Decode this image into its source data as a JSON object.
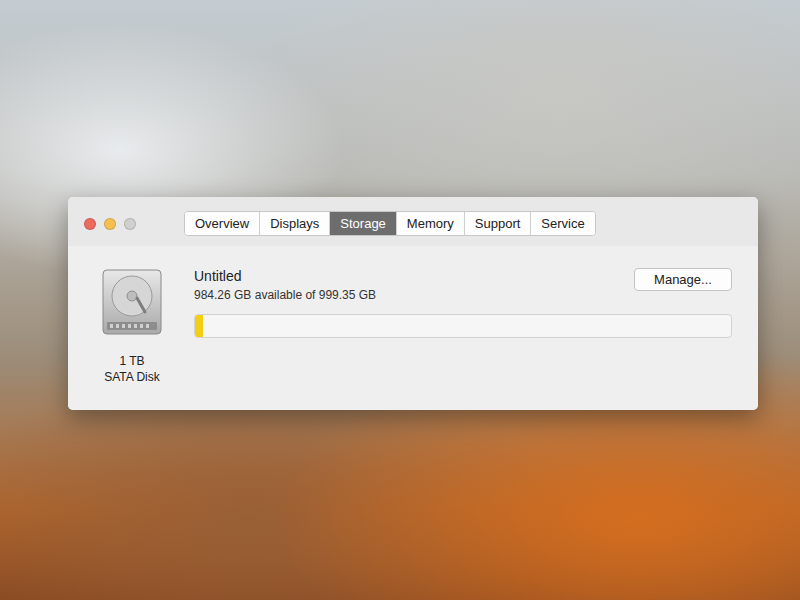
{
  "window": {
    "controls": [
      {
        "kind": "close",
        "disabled": false,
        "color": "#ed6a5e"
      },
      {
        "kind": "minimize",
        "disabled": false,
        "color": "#f5c04f"
      },
      {
        "kind": "zoom",
        "disabled": true,
        "color": "#d0d0d0"
      }
    ]
  },
  "tabs": [
    {
      "label": "Overview",
      "selected": false
    },
    {
      "label": "Displays",
      "selected": false
    },
    {
      "label": "Storage",
      "selected": true
    },
    {
      "label": "Memory",
      "selected": false
    },
    {
      "label": "Support",
      "selected": false
    },
    {
      "label": "Service",
      "selected": false
    }
  ],
  "disk": {
    "name": "Untitled",
    "capacity": "984.26 GB available of 999.35 GB",
    "size": "1 TB",
    "type": "SATA Disk",
    "level": 0.015
  },
  "buttons": [
    "Manage..."
  ]
}
